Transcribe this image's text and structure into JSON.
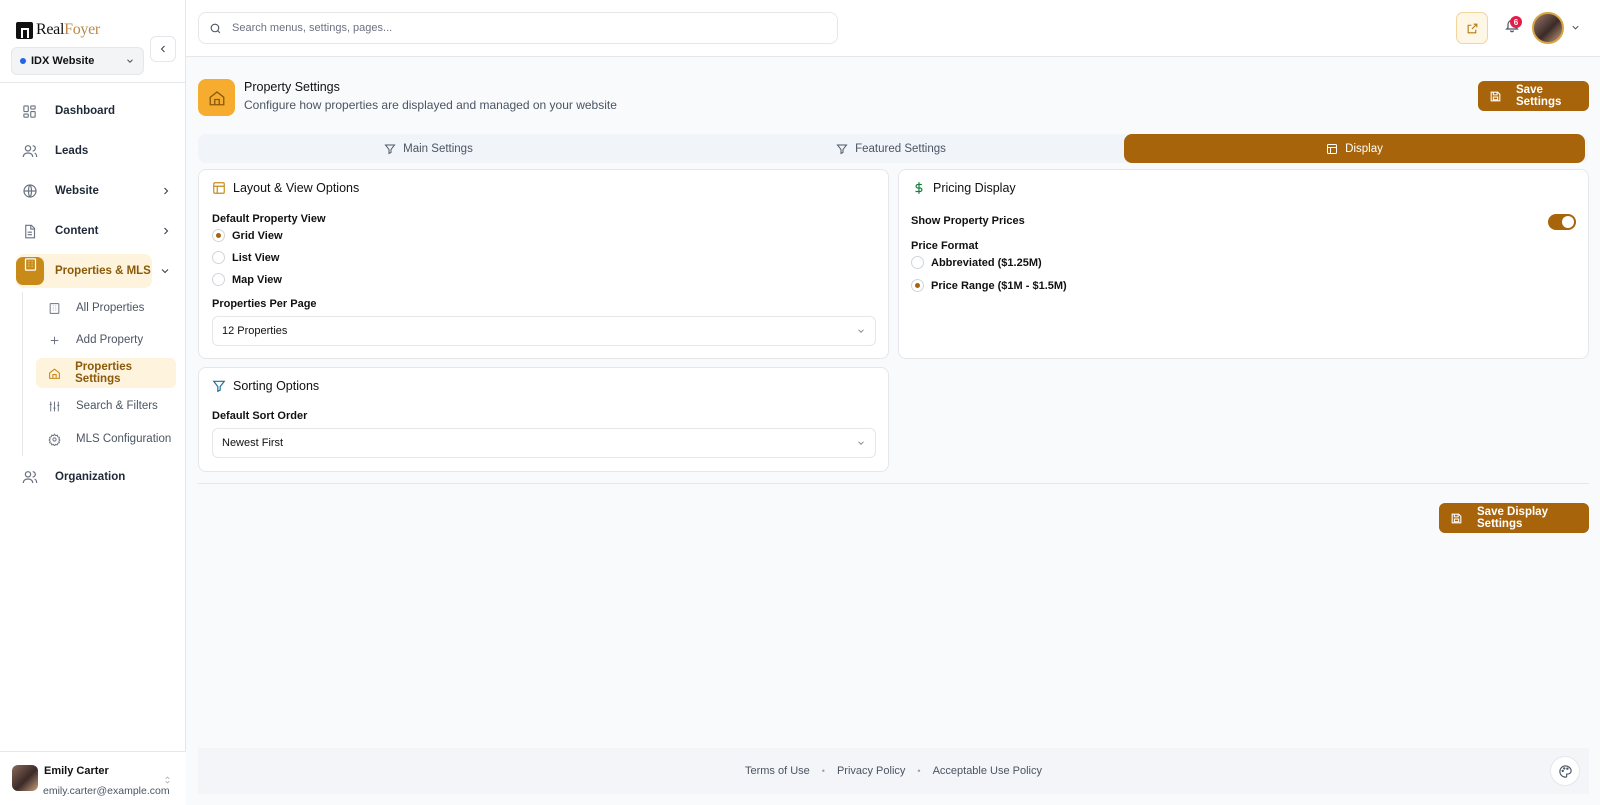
{
  "brand": {
    "name_part1": "Real",
    "name_part2": "Foyer"
  },
  "site_selector": {
    "value": "IDX Website"
  },
  "search": {
    "placeholder": "Search menus, settings, pages..."
  },
  "notifications": {
    "count": "6"
  },
  "sidebar": {
    "items": [
      {
        "label": "Dashboard",
        "icon": "grid-icon"
      },
      {
        "label": "Leads",
        "icon": "users-icon"
      },
      {
        "label": "Website",
        "icon": "globe-icon"
      },
      {
        "label": "Content",
        "icon": "document-icon"
      },
      {
        "label": "Properties & MLS",
        "icon": "building-icon"
      },
      {
        "label": "Organization",
        "icon": "users-icon"
      }
    ],
    "sub_items": [
      {
        "label": "All Properties",
        "icon": "building-icon"
      },
      {
        "label": "Add Property",
        "icon": "plus-icon"
      },
      {
        "label": "Properties Settings",
        "icon": "home-icon"
      },
      {
        "label": "Search & Filters",
        "icon": "sliders-icon"
      },
      {
        "label": "MLS Configuration",
        "icon": "gear-icon"
      }
    ]
  },
  "user": {
    "name": "Emily Carter",
    "email": "emily.carter@example.com"
  },
  "page": {
    "title": "Property Settings",
    "subtitle": "Configure how properties are displayed and managed on your website",
    "save_button": "Save Settings",
    "save_display_button": "Save Display Settings"
  },
  "tabs": [
    {
      "label": "Main Settings",
      "active": false
    },
    {
      "label": "Featured Settings",
      "active": false
    },
    {
      "label": "Display",
      "active": true
    }
  ],
  "layout_card": {
    "title": "Layout & View Options",
    "view_label": "Default Property View",
    "view_options": [
      "Grid View",
      "List View",
      "Map View"
    ],
    "selected_view": "Grid View",
    "per_page_label": "Properties Per Page",
    "per_page_value": "12 Properties"
  },
  "sorting_card": {
    "title": "Sorting Options",
    "sort_label": "Default Sort Order",
    "sort_value": "Newest First"
  },
  "pricing_card": {
    "title": "Pricing Display",
    "show_prices_label": "Show Property Prices",
    "show_prices": true,
    "format_label": "Price Format",
    "format_options": [
      "Abbreviated ($1.25M)",
      "Price Range ($1M - $1.5M)"
    ],
    "selected_format": "Price Range ($1M - $1.5M)"
  },
  "footer": {
    "links": [
      "Terms of Use",
      "Privacy Policy",
      "Acceptable Use Policy"
    ]
  },
  "colors": {
    "accent": "#a8640b",
    "accent_light": "#f6ac2e",
    "highlight_bg": "#fef3dc"
  }
}
